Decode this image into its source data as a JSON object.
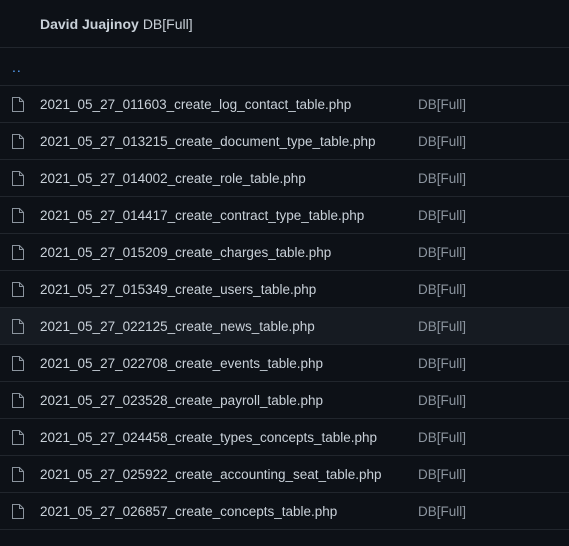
{
  "header": {
    "author": "David Juajinoy",
    "commit_message": "DB[Full]"
  },
  "parent": {
    "label": ".."
  },
  "files": [
    {
      "name": "2021_05_27_011603_create_log_contact_table.php",
      "commit": "DB[Full]",
      "icon": "file-icon"
    },
    {
      "name": "2021_05_27_013215_create_document_type_table.php",
      "commit": "DB[Full]",
      "icon": "file-icon"
    },
    {
      "name": "2021_05_27_014002_create_role_table.php",
      "commit": "DB[Full]",
      "icon": "file-icon"
    },
    {
      "name": "2021_05_27_014417_create_contract_type_table.php",
      "commit": "DB[Full]",
      "icon": "file-icon"
    },
    {
      "name": "2021_05_27_015209_create_charges_table.php",
      "commit": "DB[Full]",
      "icon": "file-icon"
    },
    {
      "name": "2021_05_27_015349_create_users_table.php",
      "commit": "DB[Full]",
      "icon": "file-icon"
    },
    {
      "name": "2021_05_27_022125_create_news_table.php",
      "commit": "DB[Full]",
      "icon": "file-icon"
    },
    {
      "name": "2021_05_27_022708_create_events_table.php",
      "commit": "DB[Full]",
      "icon": "file-icon"
    },
    {
      "name": "2021_05_27_023528_create_payroll_table.php",
      "commit": "DB[Full]",
      "icon": "file-icon"
    },
    {
      "name": "2021_05_27_024458_create_types_concepts_table.php",
      "commit": "DB[Full]",
      "icon": "file-icon"
    },
    {
      "name": "2021_05_27_025922_create_accounting_seat_table.php",
      "commit": "DB[Full]",
      "icon": "file-icon"
    },
    {
      "name": "2021_05_27_026857_create_concepts_table.php",
      "commit": "DB[Full]",
      "icon": "file-icon"
    }
  ],
  "colors": {
    "background": "#0d1117",
    "row_border": "#21262d",
    "link": "#58a6ff",
    "text": "#c9d1d9",
    "muted": "#8b949e"
  }
}
